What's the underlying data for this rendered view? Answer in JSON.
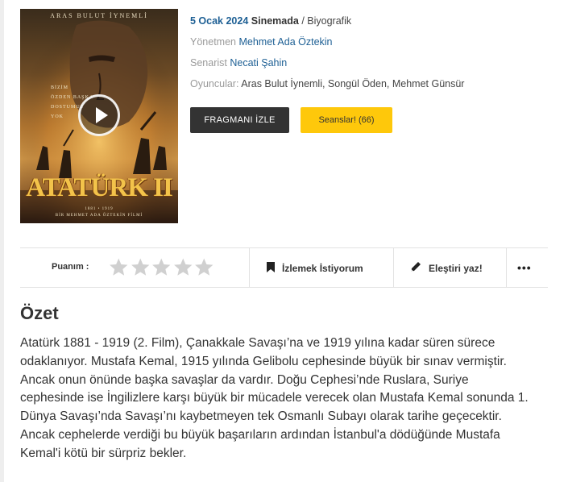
{
  "poster": {
    "actor": "ARAS BULUT İYNEMLİ",
    "tagline": [
      "BİZİM",
      "ÖZDEN BAŞKA",
      "DOSTUMUZ",
      "YOK"
    ],
    "title": "ATATÜRK II",
    "years": "1881 • 1919",
    "director": "BİR MEHMET ADA ÖZTEKİN FİLMİ"
  },
  "movie": {
    "release_date": "5 Ocak 2024",
    "status": "Sinemada",
    "separator": " / ",
    "genre": "Biyografik",
    "director_label": "Yönetmen",
    "director": "Mehmet Ada Öztekin",
    "writer_label": "Senarist",
    "writer": "Necati Şahin",
    "cast_label": "Oyuncular:",
    "cast": "Aras Bulut İynemli, Songül Öden, Mehmet Günsür"
  },
  "buttons": {
    "trailer": "FRAGMANI İZLE",
    "sessions": "Seanslar! (66)"
  },
  "actions": {
    "rating_label": "Puanım :",
    "rating_value": 0,
    "rating_max": 5,
    "watchlist": "İzlemek İstiyorum",
    "review": "Eleştiri yaz!",
    "more": "•••"
  },
  "summary": {
    "title": "Özet",
    "lines": [
      "Atatürk 1881 - 1919 (2. Film), Çanakkale Savaşı’na ve 1919 yılına kadar süren sürece",
      "odaklanıyor. Mustafa Kemal, 1915 yılında Gelibolu cephesinde büyük bir sınav vermiştir.",
      "Ancak onun önünde başka savaşlar da vardır. Doğu Cephesi’nde Ruslara, Suriye",
      "cephesinde ise İngilizlere karşı büyük bir mücadele verecek olan Mustafa Kemal sonunda 1.",
      "Dünya Savaşı’nda Savaşı’nı kaybetmeyen tek Osmanlı Subayı olarak tarihe geçecektir.",
      "Ancak cephelerde verdiği bu büyük başarıların ardından İstanbul'a dödüğünde Mustafa",
      "Kemal'i kötü bir sürpriz bekler."
    ]
  },
  "colors": {
    "link": "#1d5f94",
    "trailer_bg": "#333333",
    "sessions_bg": "#fec80b",
    "star_empty": "#d0d0d0"
  },
  "icons": {
    "play": "play-icon",
    "star": "star-icon",
    "bookmark": "bookmark-icon",
    "pencil": "pencil-icon",
    "more": "more-dots-icon"
  }
}
